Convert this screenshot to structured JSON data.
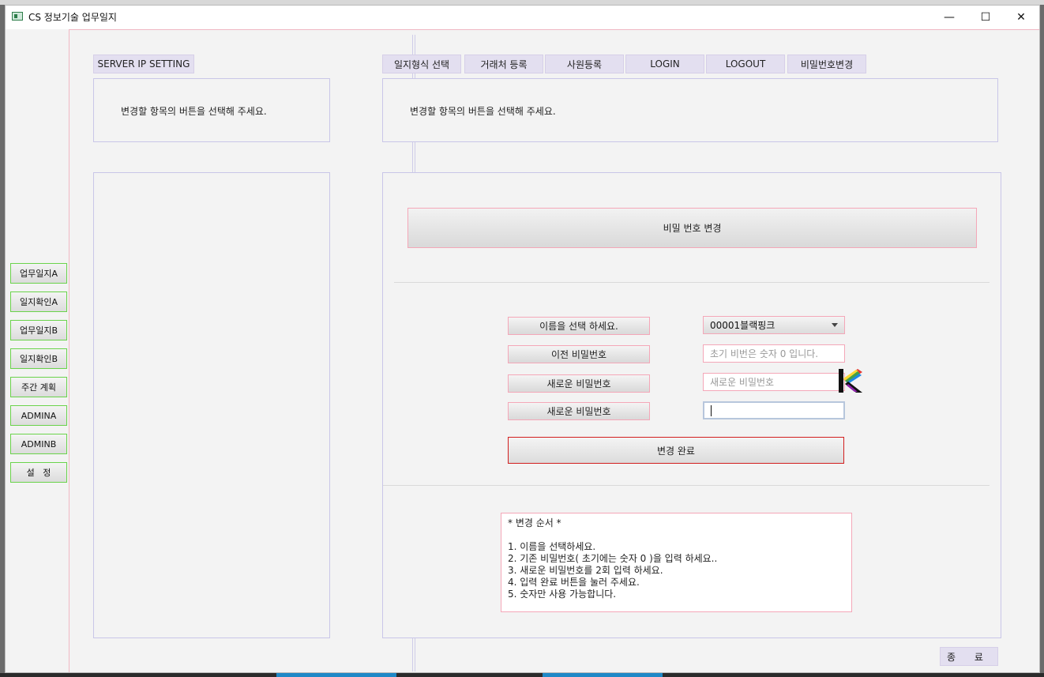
{
  "window": {
    "title": "CS 정보기술 업무일지",
    "controls": {
      "minimize": "—",
      "maximize": "☐",
      "close": "✕"
    }
  },
  "nav": {
    "items": [
      {
        "label": "업무일지A"
      },
      {
        "label": "일지확인A"
      },
      {
        "label": "업무일지B"
      },
      {
        "label": "일지확인B"
      },
      {
        "label": "주간 계획"
      },
      {
        "label": "ADMINA"
      },
      {
        "label": "ADMINB"
      },
      {
        "label": "설   정"
      }
    ]
  },
  "left_panel": {
    "tab_label": "SERVER IP SETTING",
    "message": "변경할 항목의 버튼을 선택해 주세요."
  },
  "tabs": [
    {
      "label": "일지형식 선택"
    },
    {
      "label": "거래처 등록"
    },
    {
      "label": "사원등록"
    },
    {
      "label": "LOGIN"
    },
    {
      "label": "LOGOUT"
    },
    {
      "label": "비밀번호변경"
    }
  ],
  "right_panel": {
    "message": "변경할 항목의 버튼을 선택해 주세요."
  },
  "password_form": {
    "header": "비밀 번호 변경",
    "name_label": "이름을 선택 하세요.",
    "name_value": "00001블랙핑크",
    "old_pw_label": "이전 비밀번호",
    "old_pw_placeholder": "초기 비번은 숫자 0 입니다.",
    "new_pw_label": "새로운 비밀번호",
    "new_pw_placeholder": "새로운 비밀번호",
    "confirm_pw_label": "새로운 비밀번호",
    "confirm_pw_value": "",
    "submit_label": "변경 완료"
  },
  "instructions": {
    "title": "* 변경 순서 *",
    "steps": [
      "1. 이름을 선택하세요.",
      "2. 기존 비밀번호( 초기에는 숫자 0 )을 입력 하세요..",
      "3. 새로운 비밀번호를 2회 입력 하세요.",
      "4. 입력 완료 버튼을 눌러 주세요.",
      "5. 숫자만 사용 가능합니다."
    ]
  },
  "footer": {
    "exit_label": "종 료"
  },
  "colors": {
    "accent_border": "#f4a7b8",
    "nav_border": "#6ad34b",
    "tab_bg": "#e3dff0",
    "submit_border": "#d21e1e"
  }
}
